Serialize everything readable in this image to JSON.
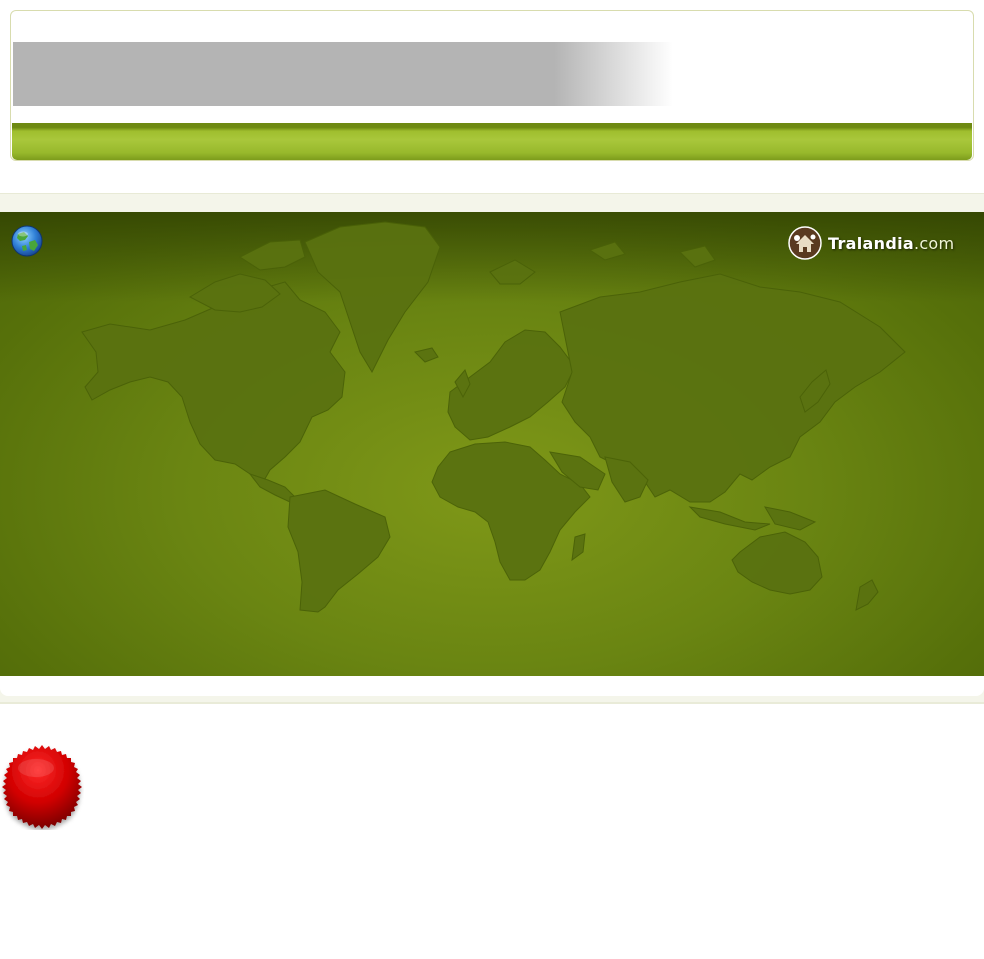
{
  "header": {
    "brand": {
      "name": "Tralandia",
      "tld": ".com"
    },
    "loading_bar_color": "#b4b4b4",
    "accent_bar_color": "#9fbe2e"
  },
  "map": {
    "background_color": "#6a8512",
    "landmass_color": "#5a7210",
    "globe_icon": "globe-icon",
    "logo_icon": "tralandia-hut-icon"
  },
  "badge": {
    "icon": "red-seal-icon",
    "color": "#cc0000"
  }
}
